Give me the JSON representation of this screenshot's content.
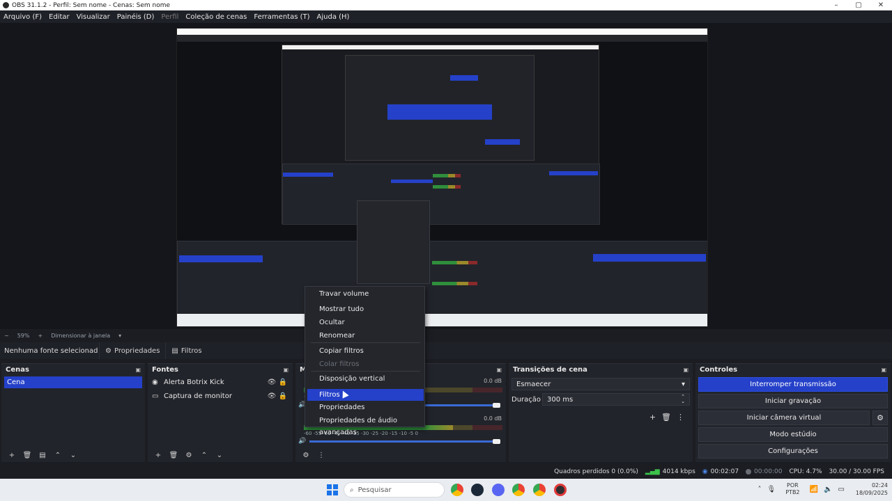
{
  "window": {
    "title": "OBS 31.1.2 - Perfil: Sem nome - Cenas: Sem nome"
  },
  "menu": [
    "Arquivo (F)",
    "Editar",
    "Visualizar",
    "Painéis (D)",
    "Perfil",
    "Coleção de cenas",
    "Ferramentas (T)",
    "Ajuda (H)"
  ],
  "zoom": {
    "value": "59%",
    "mode": "Dimensionar à janela"
  },
  "source_toolbar": {
    "status": "Nenhuma fonte selecionad",
    "properties": "Propriedades",
    "filters": "Filtros"
  },
  "scenes": {
    "title": "Cenas",
    "items": [
      {
        "label": "Cena",
        "selected": true
      }
    ]
  },
  "sources": {
    "title": "Fontes",
    "items": [
      {
        "label": "Alerta Botrix Kick",
        "icon": "globe-icon"
      },
      {
        "label": "Captura de monitor",
        "icon": "monitor-icon"
      }
    ]
  },
  "mixer": {
    "title": "Mi",
    "channels": [
      {
        "db": "0.0 dB",
        "level": 0.55
      },
      {
        "db": "0.0 dB",
        "level": 0.75
      }
    ],
    "tick_labels": [
      "-60",
      "-55",
      "-50",
      "-45",
      "-40",
      "-35",
      "-30",
      "-25",
      "-20",
      "-15",
      "-10",
      "-5",
      "0"
    ]
  },
  "transitions": {
    "title": "Transições de cena",
    "selected": "Esmaecer",
    "duration_label": "Duração",
    "duration_value": "300 ms"
  },
  "controls": {
    "title": "Controles",
    "stop_stream": "Interromper transmissão",
    "start_record": "Iniciar gravação",
    "start_vcam": "Iniciar câmera virtual",
    "studio_mode": "Modo estúdio",
    "settings": "Configurações"
  },
  "context_menu": {
    "items": [
      {
        "label": "Travar volume",
        "disabled": false,
        "highlighted": false
      },
      {
        "label": "Mostrar tudo",
        "disabled": false,
        "highlighted": false
      },
      {
        "label": "Ocultar",
        "disabled": false,
        "highlighted": false
      },
      {
        "label": "Renomear",
        "disabled": false,
        "highlighted": false
      },
      {
        "label": "Copiar filtros",
        "disabled": false,
        "highlighted": false
      },
      {
        "label": "Colar filtros",
        "disabled": true,
        "highlighted": false
      },
      {
        "label": "Disposição vertical",
        "disabled": false,
        "highlighted": false
      },
      {
        "label": "Filtros",
        "disabled": false,
        "highlighted": true
      },
      {
        "label": "Propriedades",
        "disabled": false,
        "highlighted": false
      },
      {
        "label": "Propriedades de áudio avançadas",
        "disabled": false,
        "highlighted": false
      }
    ]
  },
  "status": {
    "dropped": "Quadros perdidos 0 (0.0%)",
    "bitrate": "4014 kbps",
    "stream_time": "00:02:07",
    "rec_time": "00:00:00",
    "cpu": "CPU: 4.7%",
    "fps": "30.00 / 30.00 FPS"
  },
  "taskbar": {
    "search_placeholder": "Pesquisar",
    "lang_top": "POR",
    "lang_bottom": "PTB2",
    "time": "02:24",
    "date": "18/09/2025"
  },
  "colors": {
    "accent": "#2541c9",
    "bg": "#1b1d23",
    "panel": "#22242b",
    "meter_green": "#2f8f3c",
    "meter_yellow": "#9a8a2a",
    "meter_red": "#8a2a2a"
  }
}
